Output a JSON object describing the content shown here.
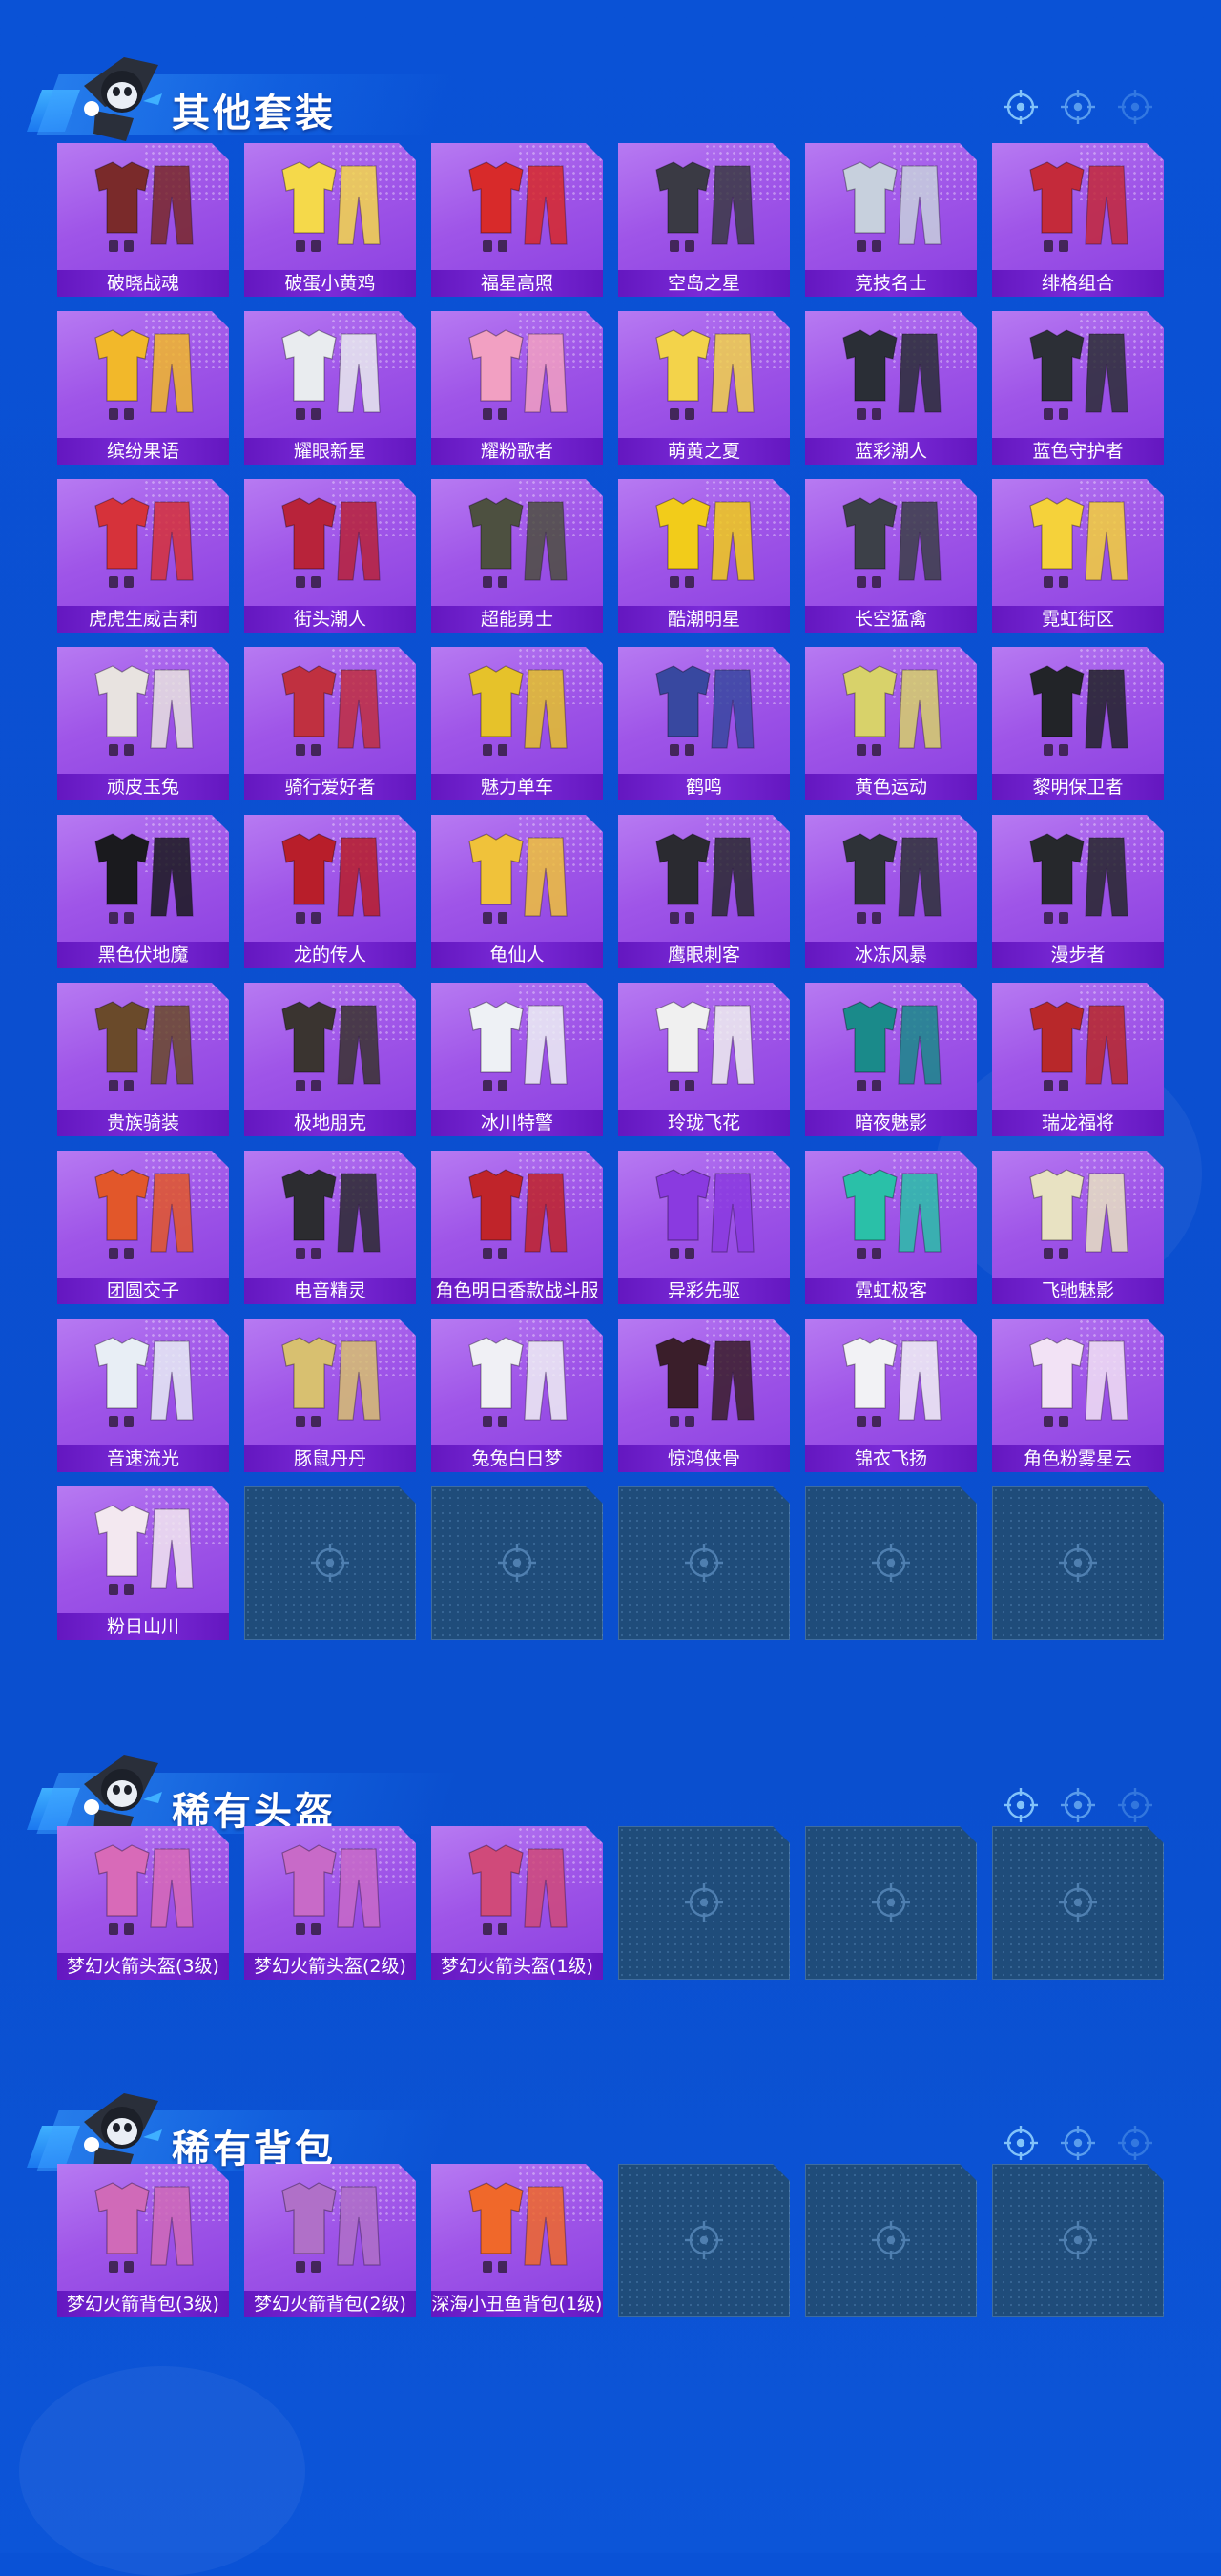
{
  "sections": [
    {
      "title": "其他套装",
      "items": [
        {
          "label": "破晓战魂",
          "color": "#7a2a2a"
        },
        {
          "label": "破蛋小黄鸡",
          "color": "#f5d94a"
        },
        {
          "label": "福星高照",
          "color": "#d82a2a"
        },
        {
          "label": "空岛之星",
          "color": "#3a3a44"
        },
        {
          "label": "竞技名士",
          "color": "#c7d0dd"
        },
        {
          "label": "绯格组合",
          "color": "#c42a3a"
        },
        {
          "label": "缤纷果语",
          "color": "#f2b82a"
        },
        {
          "label": "耀眼新星",
          "color": "#e9ecef"
        },
        {
          "label": "耀粉歌者",
          "color": "#f2a0c2"
        },
        {
          "label": "萌黄之夏",
          "color": "#f3d34a"
        },
        {
          "label": "蓝彩潮人",
          "color": "#2a2e36"
        },
        {
          "label": "蓝色守护者",
          "color": "#2c2f36"
        },
        {
          "label": "虎虎生威吉莉",
          "color": "#d6323a"
        },
        {
          "label": "街头潮人",
          "color": "#b8233a"
        },
        {
          "label": "超能勇士",
          "color": "#4d5040"
        },
        {
          "label": "酷潮明星",
          "color": "#f2cc1a"
        },
        {
          "label": "长空猛禽",
          "color": "#3c4048"
        },
        {
          "label": "霓虹街区",
          "color": "#f5d23a"
        },
        {
          "label": "顽皮玉兔",
          "color": "#e8e3e0"
        },
        {
          "label": "骑行爱好者",
          "color": "#c03040"
        },
        {
          "label": "魅力单车",
          "color": "#e6c22a"
        },
        {
          "label": "鹤鸣",
          "color": "#3848a0"
        },
        {
          "label": "黄色运动",
          "color": "#d8d26a"
        },
        {
          "label": "黎明保卫者",
          "color": "#222428"
        },
        {
          "label": "黑色伏地魔",
          "color": "#1a1a1e"
        },
        {
          "label": "龙的传人",
          "color": "#b81e2a"
        },
        {
          "label": "龟仙人",
          "color": "#f0c23a"
        },
        {
          "label": "鹰眼刺客",
          "color": "#2a2a30"
        },
        {
          "label": "冰冻风暴",
          "color": "#2e3238"
        },
        {
          "label": "漫步者",
          "color": "#26282c"
        },
        {
          "label": "贵族骑装",
          "color": "#6a4a2a"
        },
        {
          "label": "极地朋克",
          "color": "#3a3430"
        },
        {
          "label": "冰川特警",
          "color": "#eef1f5"
        },
        {
          "label": "玲珑飞花",
          "color": "#f0f0f0"
        },
        {
          "label": "暗夜魅影",
          "color": "#1a8a8a"
        },
        {
          "label": "瑞龙福将",
          "color": "#b8282a"
        },
        {
          "label": "团圆交子",
          "color": "#e2572a"
        },
        {
          "label": "电音精灵",
          "color": "#2c2c30"
        },
        {
          "label": "角色明日香款战斗服",
          "color": "#c0242a"
        },
        {
          "label": "异彩先驱",
          "color": "#8a3ae0"
        },
        {
          "label": "霓虹极客",
          "color": "#2ac0a8"
        },
        {
          "label": "飞驰魅影",
          "color": "#e8e2c2"
        },
        {
          "label": "音速流光",
          "color": "#e8eef5"
        },
        {
          "label": "豚鼠丹丹",
          "color": "#d8c070"
        },
        {
          "label": "兔兔白日梦",
          "color": "#f0f0f5"
        },
        {
          "label": "惊鸿侠骨",
          "color": "#3a1e2a"
        },
        {
          "label": "锦衣飞扬",
          "color": "#f2f2f5"
        },
        {
          "label": "角色粉雾星云",
          "color": "#f2e2f5"
        },
        {
          "label": "粉日山川",
          "color": "#f3e8f0"
        }
      ]
    },
    {
      "title": "稀有头盔",
      "items": [
        {
          "label": "梦幻火箭头盔(3级)",
          "color": "#d86ab8"
        },
        {
          "label": "梦幻火箭头盔(2级)",
          "color": "#c86ac8"
        },
        {
          "label": "梦幻火箭头盔(1级)",
          "color": "#d04a7a"
        }
      ]
    },
    {
      "title": "稀有背包",
      "items": [
        {
          "label": "梦幻火箭背包(3级)",
          "color": "#d06ab8"
        },
        {
          "label": "梦幻火箭背包(2级)",
          "color": "#b070c8"
        },
        {
          "label": "深海小丑鱼背包(1级)",
          "color": "#f0682a"
        }
      ]
    }
  ]
}
